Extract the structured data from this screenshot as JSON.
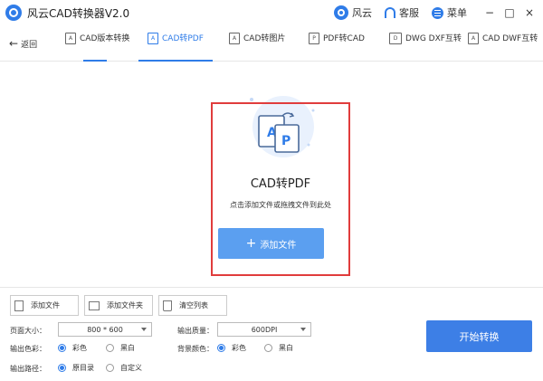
{
  "window": {
    "title": "风云CAD转换器V2.0",
    "user_label": "风云",
    "service_label": "客服",
    "menu_label": "菜单",
    "minimize": "−",
    "maximize": "□",
    "close": "×"
  },
  "toolbar": {
    "back_label": "返回",
    "tabs": [
      {
        "label": "CAD版本转换",
        "icon": "cad-version-icon"
      },
      {
        "label": "CAD转PDF",
        "icon": "cad-to-pdf-icon",
        "active": true
      },
      {
        "label": "CAD转图片",
        "icon": "cad-to-image-icon"
      },
      {
        "label": "PDF转CAD",
        "icon": "pdf-to-cad-icon"
      },
      {
        "label": "DWG DXF互转",
        "icon": "dwg-dxf-icon"
      },
      {
        "label": "CAD DWF互转",
        "icon": "cad-dwf-icon"
      }
    ]
  },
  "drop_zone": {
    "title": "CAD转PDF",
    "hint": "点击添加文件或拖拽文件到此处",
    "add_button": "添加文件"
  },
  "actions": {
    "add_file": "添加文件",
    "add_folder": "添加文件夹",
    "clear_list": "清空列表"
  },
  "settings": {
    "page_size_label": "页面大小：",
    "page_size_value": "800 * 600",
    "quality_label": "输出质量：",
    "quality_value": "600DPI",
    "color_label": "输出色彩：",
    "color_options": [
      "彩色",
      "黑白"
    ],
    "bg_label": "背景颜色：",
    "bg_options": [
      "彩色",
      "黑白"
    ],
    "path_label": "输出路径：",
    "path_options": [
      "原目录",
      "自定义"
    ]
  },
  "convert_button": "开始转换",
  "colors": {
    "accent": "#2f7ce8",
    "highlight_frame": "#e03c3c"
  }
}
